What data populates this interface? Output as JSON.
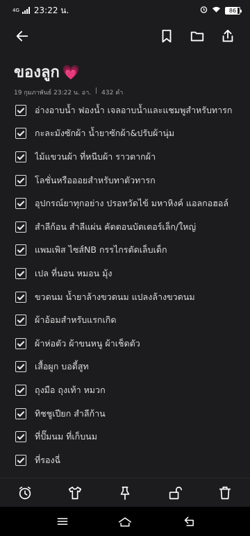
{
  "status_bar": {
    "network": "4G",
    "time": "23:22 น.",
    "battery": "86"
  },
  "toolbar": {
    "icons": [
      "back-arrow-icon",
      "bookmark-icon",
      "folder-icon",
      "share-icon"
    ]
  },
  "note": {
    "title": "ของลูก",
    "emoji": "💗",
    "date": "19 กุมภาพันธ์ 23:22 น. อา.",
    "separator": "|",
    "char_count": "432 คำ"
  },
  "checklist": [
    {
      "text": "อ่างอาบน้ำ ฟองน้ำ เจลอาบน้ำและแชมพูสำหรับทารก",
      "checked": true
    },
    {
      "text": "กะละมังซักผ้า น้ำยาซักผ้า&ปรับผ้านุ่ม",
      "checked": true
    },
    {
      "text": "ไม้แขวนผ้า ที่หนีบผ้า ราวตากผ้า",
      "checked": true
    },
    {
      "text": "โลชั่นหรือออยสำหรับทาตัวทารก",
      "checked": true
    },
    {
      "text": "อุปกรณ์ยาทุกอย่าง ปรอทวัดไข้ มหาหิงค์ แอลกอฮอล์",
      "checked": true
    },
    {
      "text": "สำลีก้อน สำลีแผ่น คัตตอนบัตเตอร์เล็ก/ใหญ่",
      "checked": true
    },
    {
      "text": "แพมเพิส ไซส์NB กรรไกรตัดเล็บเด็ก",
      "checked": true
    },
    {
      "text": "เปล ที่นอน หมอน มุ้ง",
      "checked": true
    },
    {
      "text": "ขวดนม น้ำยาล้างขวดนม แปลงล้างขวดนม",
      "checked": true
    },
    {
      "text": "ผ้าอ้อมสำหรับแรกเกิด",
      "checked": true
    },
    {
      "text": "ผ้าห่อตัว ผ้าขนหนู ผ้าเช็ดตัว",
      "checked": true
    },
    {
      "text": "เสื้อผูก บอดี้สูท",
      "checked": true
    },
    {
      "text": "ถุงมือ ถุงเท้า หมวก",
      "checked": true
    },
    {
      "text": "ทิชชูเปียก สำลีก้าน",
      "checked": true
    },
    {
      "text": "ที่ปั๊มนม ที่เก็บนม",
      "checked": true
    },
    {
      "text": "ที่รองฉี่",
      "checked": true
    }
  ],
  "bottom_actions": {
    "icons": [
      "alarm-clock-icon",
      "shirt-icon",
      "pin-icon",
      "unlock-icon",
      "trash-icon"
    ]
  },
  "nav_bar": {
    "icons": [
      "menu-icon",
      "home-icon",
      "back-icon"
    ]
  },
  "colors": {
    "background": "#1c1c1e",
    "text": "#dcdcdc",
    "accent_heart": "#ff3d8b",
    "nav_bar": "#000000"
  }
}
